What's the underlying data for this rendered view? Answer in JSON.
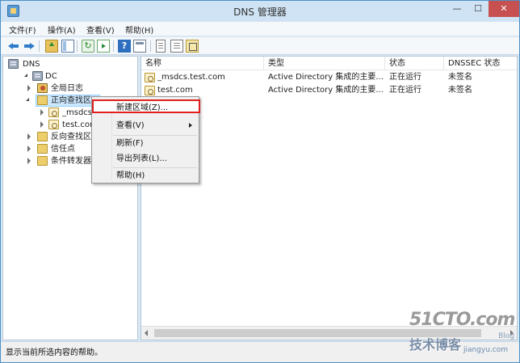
{
  "window": {
    "title": "DNS 管理器",
    "min_label": "—",
    "max_label": "☐",
    "close_label": "✕"
  },
  "menu": [
    "文件(F)",
    "操作(A)",
    "查看(V)",
    "帮助(H)"
  ],
  "toolbar": {
    "icons": [
      "back-arrow-icon",
      "forward-arrow-icon",
      "up-folder-icon",
      "show-hide-tree-icon",
      "refresh-icon",
      "export-list-icon",
      "help-icon",
      "action-pane-icon",
      "list-view-icon",
      "detail-view-icon",
      "properties-icon"
    ],
    "help_glyph": "?",
    "refresh_glyph": "↻"
  },
  "tree": {
    "root": "DNS",
    "server": "DC",
    "items": [
      {
        "label": "全局日志",
        "icon": "global-log-icon"
      },
      {
        "label": "正向查找区域",
        "icon": "folder-icon",
        "selected": true
      },
      {
        "label": "_msdcs.test.com",
        "icon": "zone-icon"
      },
      {
        "label": "test.com",
        "icon": "zone-icon"
      },
      {
        "label": "反向查找区域",
        "icon": "folder-icon"
      },
      {
        "label": "信任点",
        "icon": "folder-icon"
      },
      {
        "label": "条件转发器",
        "icon": "folder-icon"
      }
    ],
    "visible_labels": {
      "forward_zone": "正向查找区",
      "msdcs": "_msdcs",
      "test": "test.con",
      "reverse": "反向查找区"
    }
  },
  "table": {
    "columns": [
      "名称",
      "类型",
      "状态",
      "DNSSEC 状态"
    ],
    "rows": [
      {
        "name": "_msdcs.test.com",
        "type": "Active Directory 集成的主要...",
        "status": "正在运行",
        "dnssec": "未签名"
      },
      {
        "name": "test.com",
        "type": "Active Directory 集成的主要...",
        "status": "正在运行",
        "dnssec": "未签名"
      }
    ]
  },
  "context_menu": {
    "items": [
      {
        "label": "新建区域(Z)...",
        "highlighted": true
      },
      {
        "label": "查看(V)",
        "submenu": true
      },
      {
        "label": "刷新(F)"
      },
      {
        "label": "导出列表(L)..."
      },
      {
        "label": "帮助(H)"
      }
    ]
  },
  "status": {
    "text": "显示当前所选内容的帮助。"
  },
  "watermark": {
    "main": "51CTO.com",
    "sub": "技术博客",
    "blog": "Blog",
    "small": "jiangyu.com"
  }
}
